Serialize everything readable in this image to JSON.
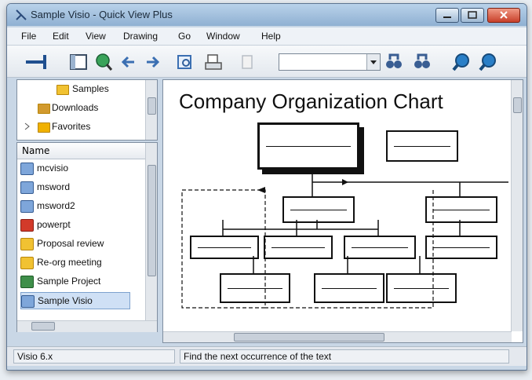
{
  "window": {
    "title": "Sample Visio - Quick View Plus"
  },
  "menu": [
    "File",
    "Edit",
    "View",
    "Drawing",
    "Go",
    "Window",
    "Help"
  ],
  "toolbar": {
    "combo_value": ""
  },
  "tree": {
    "items": [
      "Samples",
      "Downloads",
      "Favorites"
    ]
  },
  "filelist": {
    "column": "Name",
    "files": [
      "mcvisio",
      "msword",
      "msword2",
      "powerpt",
      "Proposal review",
      "Re-org meeting",
      "Sample Project",
      "Sample Visio"
    ],
    "selected": "Sample Visio"
  },
  "document": {
    "title": "Company Organization Chart",
    "zoom_label": "Find Next"
  },
  "status": {
    "left": "Visio 6.x",
    "message": "Find the next occurrence of the text"
  }
}
